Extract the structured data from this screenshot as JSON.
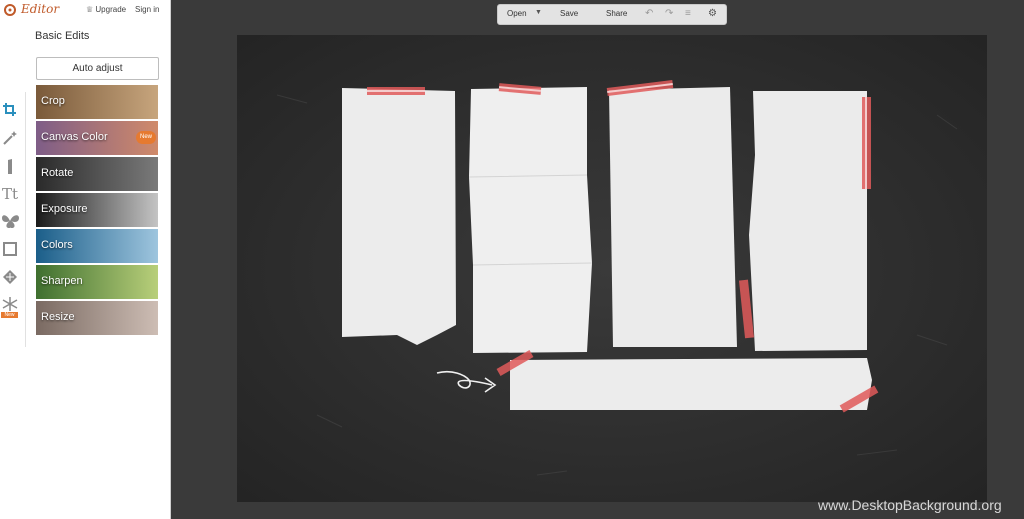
{
  "brand": {
    "name": "Editor",
    "upgrade_label": "Upgrade",
    "signin_label": "Sign in"
  },
  "section_title": "Basic Edits",
  "auto_adjust_label": "Auto adjust",
  "icon_rail": {
    "icons": [
      "crop-icon",
      "magic-wand-icon",
      "lipstick-icon",
      "text-icon",
      "butterfly-icon",
      "frame-icon",
      "texture-icon",
      "snowflake-icon"
    ],
    "glyphs": {
      "text": "Tt"
    },
    "new_badge": "New"
  },
  "tools": [
    {
      "label": "Crop",
      "colors": [
        "#7a5a3a",
        "#c7a57d"
      ],
      "badge": ""
    },
    {
      "label": "Canvas Color",
      "colors": [
        "#7e5d87",
        "#d08a6a"
      ],
      "badge": "New"
    },
    {
      "label": "Rotate",
      "colors": [
        "#2a2a2a",
        "#7a7a7a"
      ],
      "badge": ""
    },
    {
      "label": "Exposure",
      "colors": [
        "#1b1b1b",
        "#c4c4c4"
      ],
      "badge": ""
    },
    {
      "label": "Colors",
      "colors": [
        "#1b5e89",
        "#9ec5de"
      ],
      "badge": ""
    },
    {
      "label": "Sharpen",
      "colors": [
        "#3f6f2f",
        "#b8cf7a"
      ],
      "badge": ""
    },
    {
      "label": "Resize",
      "colors": [
        "#7a6a62",
        "#cdbdb4"
      ],
      "badge": ""
    }
  ],
  "toolbar": {
    "open_label": "Open",
    "save_label": "Save",
    "share_label": "Share",
    "icons": [
      "undo-icon",
      "redo-icon",
      "layers-icon",
      "gear-icon"
    ]
  },
  "canvas": {
    "description_color": "#2d2d2d"
  },
  "watermark": "www.DesktopBackground.org",
  "colors": {
    "accent": "#2a8fbd",
    "orange": "#e67a30",
    "tape": "#e05a5a"
  }
}
